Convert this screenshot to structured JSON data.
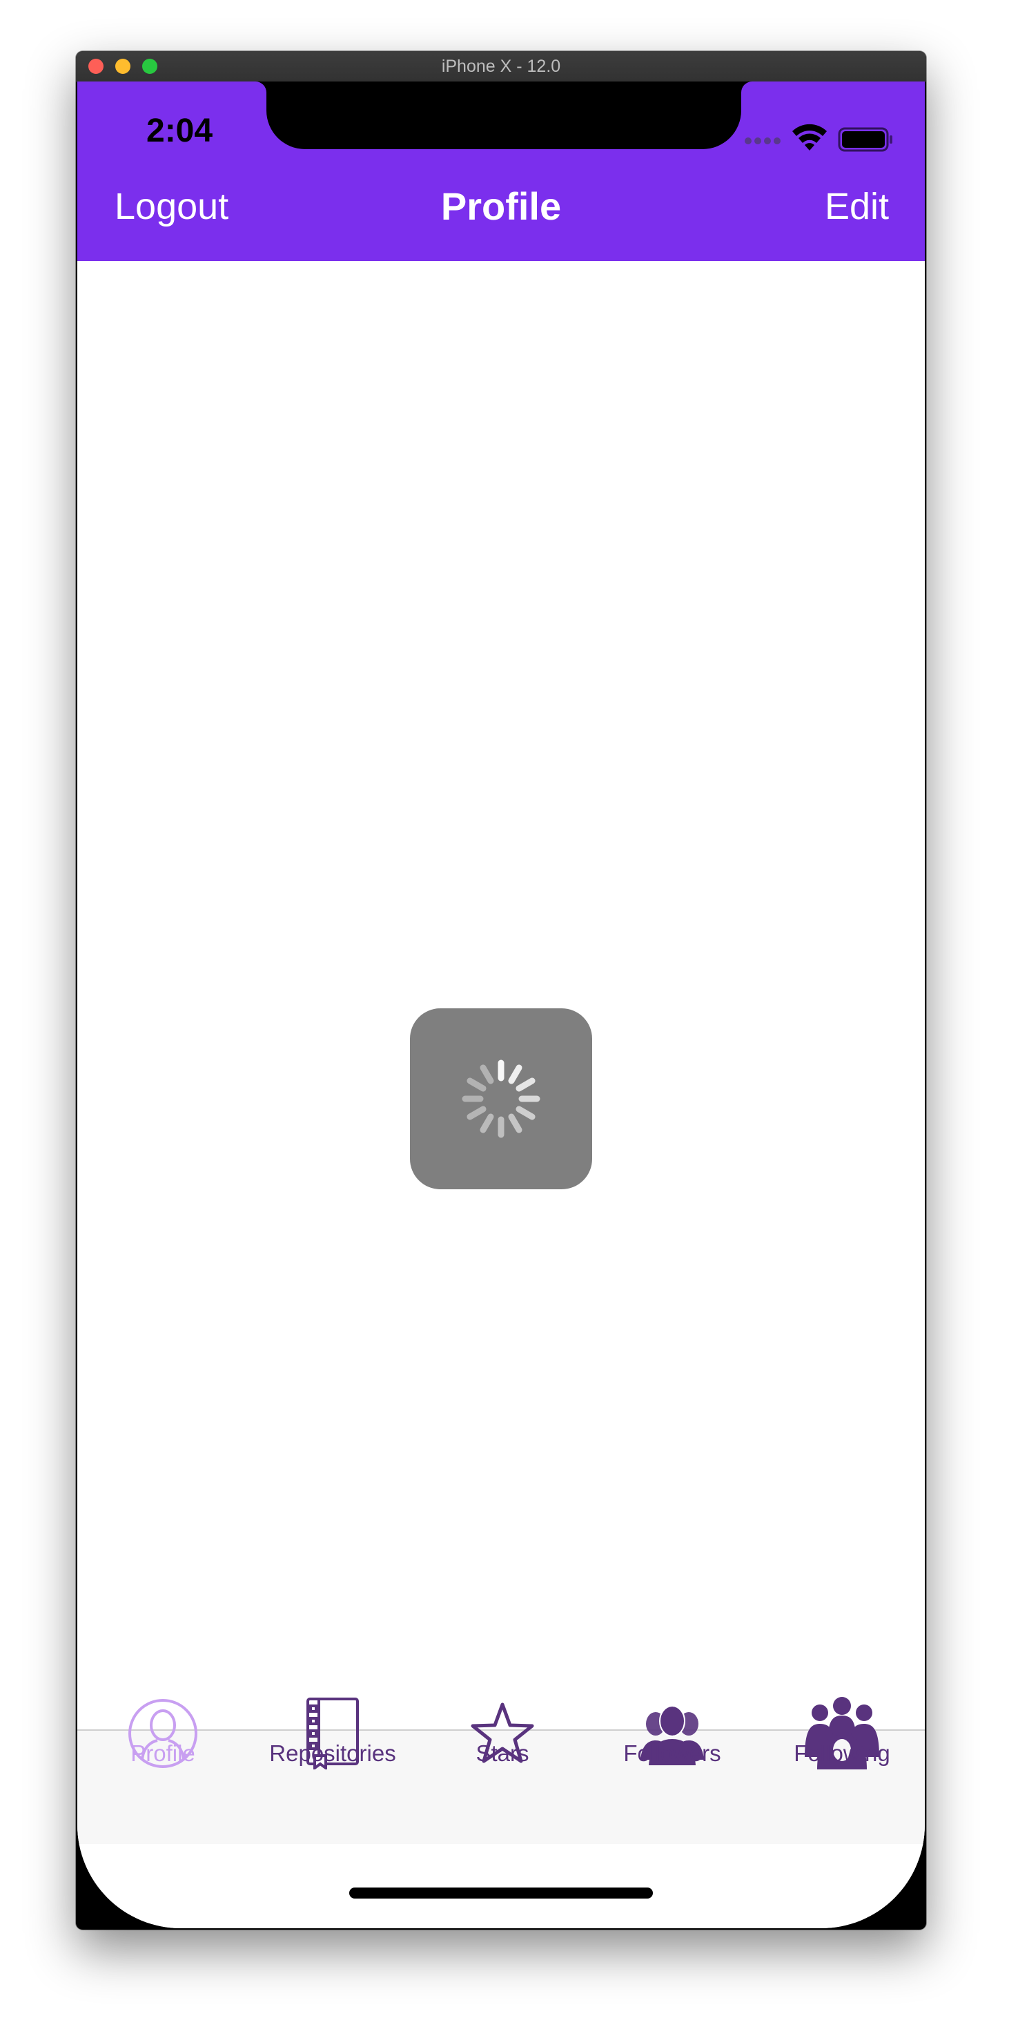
{
  "window": {
    "title": "iPhone X - 12.0"
  },
  "status_bar": {
    "time": "2:04",
    "icons": [
      "signal-dots-icon",
      "wifi-icon",
      "battery-icon"
    ]
  },
  "nav_bar": {
    "left_label": "Logout",
    "title": "Profile",
    "right_label": "Edit"
  },
  "loading": {
    "icon": "activity-spinner-icon"
  },
  "tab_bar": {
    "items": [
      {
        "label": "Profile",
        "icon": "person-icon",
        "active": true
      },
      {
        "label": "Repositories",
        "icon": "repository-book-icon",
        "active": false
      },
      {
        "label": "Stars",
        "icon": "star-icon",
        "active": false
      },
      {
        "label": "Followers",
        "icon": "followers-icon",
        "active": false
      },
      {
        "label": "Following",
        "icon": "following-group-icon",
        "active": false
      }
    ]
  },
  "colors": {
    "brand": "#7b2fed",
    "tab_active": "#c89ff1",
    "tab_inactive": "#59337e",
    "hud_background": "#7f7f7f"
  }
}
